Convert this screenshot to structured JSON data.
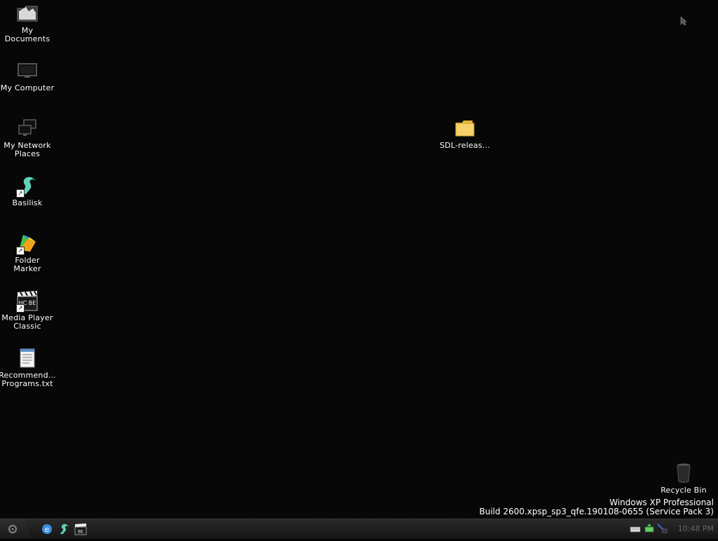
{
  "desktop": {
    "icons": [
      {
        "name": "my-documents",
        "label": "My\nDocuments",
        "icon": "folder-documents-icon"
      },
      {
        "name": "my-computer",
        "label": "My Computer",
        "icon": "monitor-icon"
      },
      {
        "name": "my-network-places",
        "label": "My Network\nPlaces",
        "icon": "network-icon"
      },
      {
        "name": "basilisk",
        "label": "Basilisk",
        "icon": "basilisk-icon"
      },
      {
        "name": "folder-marker",
        "label": "Folder\nMarker",
        "icon": "folder-marker-icon"
      },
      {
        "name": "media-player-classic",
        "label": "Media Player\nClassic",
        "icon": "clapperboard-icon"
      },
      {
        "name": "recommended-programs",
        "label": "Recommend...\nPrograms.txt",
        "icon": "text-file-icon"
      }
    ],
    "folder_sdl": {
      "label": "SDL-releas..."
    },
    "recycle_bin": {
      "label": "Recycle Bin"
    },
    "version": {
      "line1": "Windows XP Professional",
      "line2": "Build 2600.xpsp_sp3_qfe.190108-0655 (Service Pack 3)"
    }
  },
  "taskbar": {
    "quick_launch": [
      "ie-icon",
      "basilisk-icon",
      "media-player-classic-icon"
    ],
    "tray_icons": [
      "keyboard-icon",
      "safely-remove-icon",
      "network-tray-icon"
    ],
    "clock": "10:48 PM"
  }
}
